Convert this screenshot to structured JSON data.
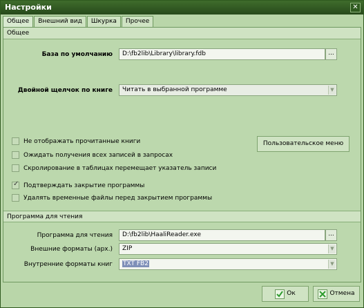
{
  "window": {
    "title": "Настройки",
    "close_glyph": "✕"
  },
  "tabs": [
    {
      "label": "Общее",
      "active": true
    },
    {
      "label": "Внешний вид",
      "active": false
    },
    {
      "label": "Шкурка",
      "active": false
    },
    {
      "label": "Прочее",
      "active": false
    }
  ],
  "general": {
    "header": "Общее",
    "default_db_label": "База по умолчанию",
    "default_db_value": "D:\\fb2lib\\Library\\library.fdb",
    "browse_label": "...",
    "double_click_label": "Двойной щелчок по книге",
    "double_click_value": "Читать в выбранной программе",
    "user_menu_button": "Пользовательское меню",
    "checkboxes": [
      {
        "label": "Не отображать прочитанные книги",
        "checked": false
      },
      {
        "label": "Ожидать получения всех записей в запросах",
        "checked": false
      },
      {
        "label": "Скролирование в таблицах перемещает указатель записи",
        "checked": false
      },
      {
        "label": "Подтверждать закрытие программы",
        "checked": true
      },
      {
        "label": "Удалять временные файлы перед закрытием программы",
        "checked": false
      }
    ]
  },
  "reading": {
    "header": "Программа для чтения",
    "program_label": "Программа для чтения",
    "program_value": "D:\\fb2lib\\HaaliReader.exe",
    "browse_label": "...",
    "external_label": "Внешние форматы (арх.)",
    "external_value": "ZIP",
    "internal_label": "Внутренние форматы книг",
    "internal_value": "TXT FB2"
  },
  "footer": {
    "ok_label": "Ок",
    "cancel_label": "Отмена"
  },
  "colors": {
    "accent": "#274a1b",
    "panel": "#bcd8ad",
    "ok_icon": "#2e9b2e",
    "cancel_icon": "#2e9b2e"
  }
}
